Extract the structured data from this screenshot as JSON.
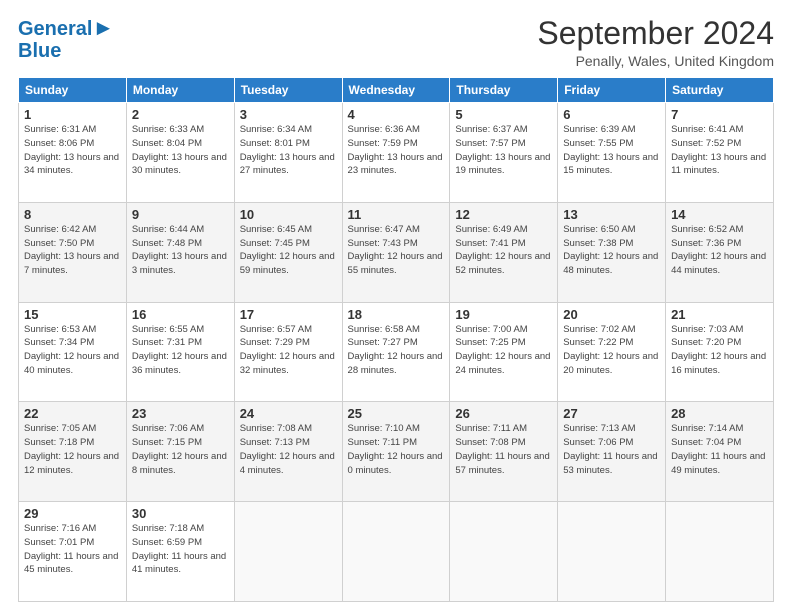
{
  "header": {
    "logo_line1": "General",
    "logo_line2": "Blue",
    "month_title": "September 2024",
    "location": "Penally, Wales, United Kingdom"
  },
  "weekdays": [
    "Sunday",
    "Monday",
    "Tuesday",
    "Wednesday",
    "Thursday",
    "Friday",
    "Saturday"
  ],
  "weeks": [
    [
      {
        "day": "1",
        "sunrise": "6:31 AM",
        "sunset": "8:06 PM",
        "daylight": "13 hours and 34 minutes."
      },
      {
        "day": "2",
        "sunrise": "6:33 AM",
        "sunset": "8:04 PM",
        "daylight": "13 hours and 30 minutes."
      },
      {
        "day": "3",
        "sunrise": "6:34 AM",
        "sunset": "8:01 PM",
        "daylight": "13 hours and 27 minutes."
      },
      {
        "day": "4",
        "sunrise": "6:36 AM",
        "sunset": "7:59 PM",
        "daylight": "13 hours and 23 minutes."
      },
      {
        "day": "5",
        "sunrise": "6:37 AM",
        "sunset": "7:57 PM",
        "daylight": "13 hours and 19 minutes."
      },
      {
        "day": "6",
        "sunrise": "6:39 AM",
        "sunset": "7:55 PM",
        "daylight": "13 hours and 15 minutes."
      },
      {
        "day": "7",
        "sunrise": "6:41 AM",
        "sunset": "7:52 PM",
        "daylight": "13 hours and 11 minutes."
      }
    ],
    [
      {
        "day": "8",
        "sunrise": "6:42 AM",
        "sunset": "7:50 PM",
        "daylight": "13 hours and 7 minutes."
      },
      {
        "day": "9",
        "sunrise": "6:44 AM",
        "sunset": "7:48 PM",
        "daylight": "13 hours and 3 minutes."
      },
      {
        "day": "10",
        "sunrise": "6:45 AM",
        "sunset": "7:45 PM",
        "daylight": "12 hours and 59 minutes."
      },
      {
        "day": "11",
        "sunrise": "6:47 AM",
        "sunset": "7:43 PM",
        "daylight": "12 hours and 55 minutes."
      },
      {
        "day": "12",
        "sunrise": "6:49 AM",
        "sunset": "7:41 PM",
        "daylight": "12 hours and 52 minutes."
      },
      {
        "day": "13",
        "sunrise": "6:50 AM",
        "sunset": "7:38 PM",
        "daylight": "12 hours and 48 minutes."
      },
      {
        "day": "14",
        "sunrise": "6:52 AM",
        "sunset": "7:36 PM",
        "daylight": "12 hours and 44 minutes."
      }
    ],
    [
      {
        "day": "15",
        "sunrise": "6:53 AM",
        "sunset": "7:34 PM",
        "daylight": "12 hours and 40 minutes."
      },
      {
        "day": "16",
        "sunrise": "6:55 AM",
        "sunset": "7:31 PM",
        "daylight": "12 hours and 36 minutes."
      },
      {
        "day": "17",
        "sunrise": "6:57 AM",
        "sunset": "7:29 PM",
        "daylight": "12 hours and 32 minutes."
      },
      {
        "day": "18",
        "sunrise": "6:58 AM",
        "sunset": "7:27 PM",
        "daylight": "12 hours and 28 minutes."
      },
      {
        "day": "19",
        "sunrise": "7:00 AM",
        "sunset": "7:25 PM",
        "daylight": "12 hours and 24 minutes."
      },
      {
        "day": "20",
        "sunrise": "7:02 AM",
        "sunset": "7:22 PM",
        "daylight": "12 hours and 20 minutes."
      },
      {
        "day": "21",
        "sunrise": "7:03 AM",
        "sunset": "7:20 PM",
        "daylight": "12 hours and 16 minutes."
      }
    ],
    [
      {
        "day": "22",
        "sunrise": "7:05 AM",
        "sunset": "7:18 PM",
        "daylight": "12 hours and 12 minutes."
      },
      {
        "day": "23",
        "sunrise": "7:06 AM",
        "sunset": "7:15 PM",
        "daylight": "12 hours and 8 minutes."
      },
      {
        "day": "24",
        "sunrise": "7:08 AM",
        "sunset": "7:13 PM",
        "daylight": "12 hours and 4 minutes."
      },
      {
        "day": "25",
        "sunrise": "7:10 AM",
        "sunset": "7:11 PM",
        "daylight": "12 hours and 0 minutes."
      },
      {
        "day": "26",
        "sunrise": "7:11 AM",
        "sunset": "7:08 PM",
        "daylight": "11 hours and 57 minutes."
      },
      {
        "day": "27",
        "sunrise": "7:13 AM",
        "sunset": "7:06 PM",
        "daylight": "11 hours and 53 minutes."
      },
      {
        "day": "28",
        "sunrise": "7:14 AM",
        "sunset": "7:04 PM",
        "daylight": "11 hours and 49 minutes."
      }
    ],
    [
      {
        "day": "29",
        "sunrise": "7:16 AM",
        "sunset": "7:01 PM",
        "daylight": "11 hours and 45 minutes."
      },
      {
        "day": "30",
        "sunrise": "7:18 AM",
        "sunset": "6:59 PM",
        "daylight": "11 hours and 41 minutes."
      },
      null,
      null,
      null,
      null,
      null
    ]
  ]
}
